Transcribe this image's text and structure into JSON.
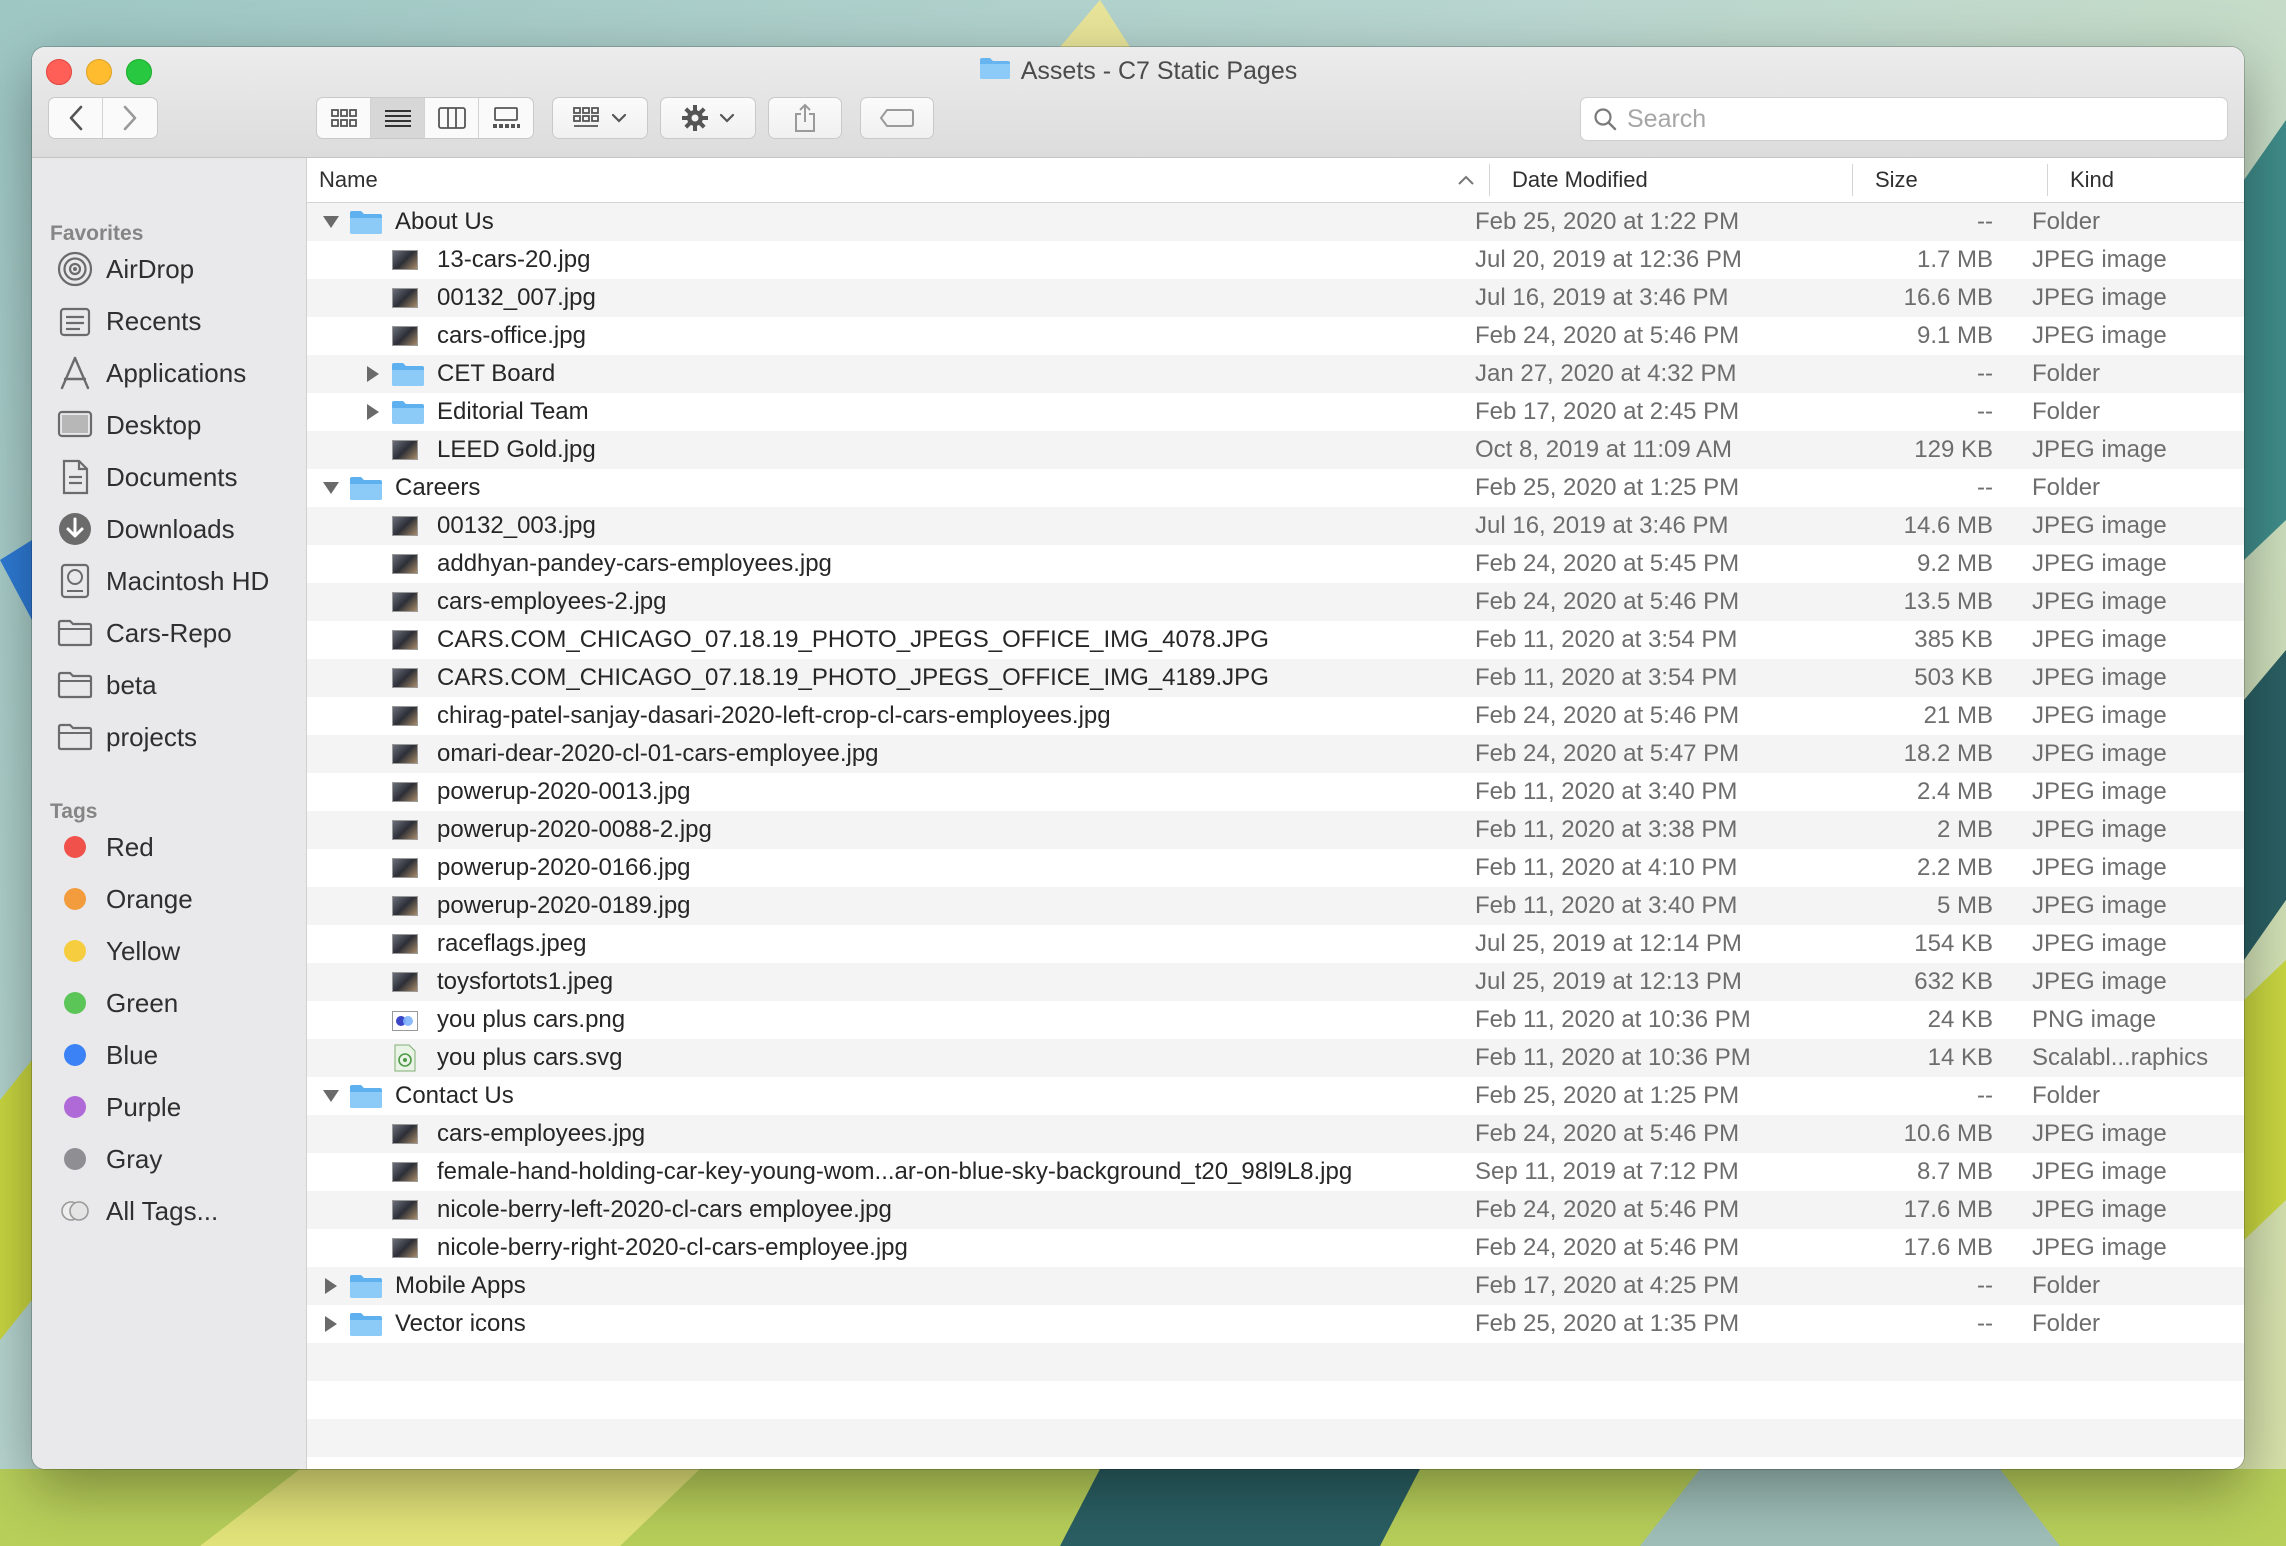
{
  "window": {
    "title": "Assets - C7 Static Pages"
  },
  "toolbar": {
    "back_icon": "chevron-left-icon",
    "forward_icon": "chevron-right-icon",
    "views": [
      "icon-view-icon",
      "list-view-icon",
      "column-view-icon",
      "gallery-view-icon"
    ],
    "active_view": "list",
    "search_placeholder": "Search"
  },
  "sidebar": {
    "favorites_heading": "Favorites",
    "favorites": [
      {
        "label": "AirDrop",
        "icon": "airdrop-icon"
      },
      {
        "label": "Recents",
        "icon": "recents-icon"
      },
      {
        "label": "Applications",
        "icon": "applications-icon"
      },
      {
        "label": "Desktop",
        "icon": "desktop-icon"
      },
      {
        "label": "Documents",
        "icon": "documents-icon"
      },
      {
        "label": "Downloads",
        "icon": "downloads-icon"
      },
      {
        "label": "Macintosh HD",
        "icon": "hard-drive-icon"
      },
      {
        "label": "Cars-Repo",
        "icon": "folder-icon"
      },
      {
        "label": "beta",
        "icon": "folder-icon"
      },
      {
        "label": "projects",
        "icon": "folder-icon"
      }
    ],
    "tags_heading": "Tags",
    "tags": [
      {
        "label": "Red",
        "color": "#f0524b"
      },
      {
        "label": "Orange",
        "color": "#f39c3e"
      },
      {
        "label": "Yellow",
        "color": "#f6cd3e"
      },
      {
        "label": "Green",
        "color": "#5bc657"
      },
      {
        "label": "Blue",
        "color": "#3b82f6"
      },
      {
        "label": "Purple",
        "color": "#b06ad8"
      },
      {
        "label": "Gray",
        "color": "#8e8e93"
      },
      {
        "label": "All Tags...",
        "color": ""
      }
    ]
  },
  "columns": {
    "name": "Name",
    "date": "Date Modified",
    "size": "Size",
    "kind": "Kind"
  },
  "rows": [
    {
      "level": 0,
      "type": "folder",
      "expanded": true,
      "name": "About Us",
      "date": "Feb 25, 2020 at 1:22 PM",
      "size": "--",
      "kind": "Folder"
    },
    {
      "level": 1,
      "type": "image",
      "name": "13-cars-20.jpg",
      "date": "Jul 20, 2019 at 12:36 PM",
      "size": "1.7 MB",
      "kind": "JPEG image"
    },
    {
      "level": 1,
      "type": "image",
      "name": "00132_007.jpg",
      "date": "Jul 16, 2019 at 3:46 PM",
      "size": "16.6 MB",
      "kind": "JPEG image"
    },
    {
      "level": 1,
      "type": "image",
      "name": "cars-office.jpg",
      "date": "Feb 24, 2020 at 5:46 PM",
      "size": "9.1 MB",
      "kind": "JPEG image"
    },
    {
      "level": 1,
      "type": "folder",
      "expanded": false,
      "name": "CET Board",
      "date": "Jan 27, 2020 at 4:32 PM",
      "size": "--",
      "kind": "Folder"
    },
    {
      "level": 1,
      "type": "folder",
      "expanded": false,
      "name": "Editorial Team",
      "date": "Feb 17, 2020 at 2:45 PM",
      "size": "--",
      "kind": "Folder"
    },
    {
      "level": 1,
      "type": "image",
      "name": "LEED Gold.jpg",
      "date": "Oct 8, 2019 at 11:09 AM",
      "size": "129 KB",
      "kind": "JPEG image"
    },
    {
      "level": 0,
      "type": "folder",
      "expanded": true,
      "name": "Careers",
      "date": "Feb 25, 2020 at 1:25 PM",
      "size": "--",
      "kind": "Folder"
    },
    {
      "level": 1,
      "type": "image",
      "name": "00132_003.jpg",
      "date": "Jul 16, 2019 at 3:46 PM",
      "size": "14.6 MB",
      "kind": "JPEG image"
    },
    {
      "level": 1,
      "type": "image",
      "name": "addhyan-pandey-cars-employees.jpg",
      "date": "Feb 24, 2020 at 5:45 PM",
      "size": "9.2 MB",
      "kind": "JPEG image"
    },
    {
      "level": 1,
      "type": "image",
      "name": "cars-employees-2.jpg",
      "date": "Feb 24, 2020 at 5:46 PM",
      "size": "13.5 MB",
      "kind": "JPEG image"
    },
    {
      "level": 1,
      "type": "image",
      "name": "CARS.COM_CHICAGO_07.18.19_PHOTO_JPEGS_OFFICE_IMG_4078.JPG",
      "date": "Feb 11, 2020 at 3:54 PM",
      "size": "385 KB",
      "kind": "JPEG image"
    },
    {
      "level": 1,
      "type": "image",
      "name": "CARS.COM_CHICAGO_07.18.19_PHOTO_JPEGS_OFFICE_IMG_4189.JPG",
      "date": "Feb 11, 2020 at 3:54 PM",
      "size": "503 KB",
      "kind": "JPEG image"
    },
    {
      "level": 1,
      "type": "image",
      "name": "chirag-patel-sanjay-dasari-2020-left-crop-cl-cars-employees.jpg",
      "date": "Feb 24, 2020 at 5:46 PM",
      "size": "21 MB",
      "kind": "JPEG image"
    },
    {
      "level": 1,
      "type": "image",
      "name": "omari-dear-2020-cl-01-cars-employee.jpg",
      "date": "Feb 24, 2020 at 5:47 PM",
      "size": "18.2 MB",
      "kind": "JPEG image"
    },
    {
      "level": 1,
      "type": "image",
      "name": "powerup-2020-0013.jpg",
      "date": "Feb 11, 2020 at 3:40 PM",
      "size": "2.4 MB",
      "kind": "JPEG image"
    },
    {
      "level": 1,
      "type": "image",
      "name": "powerup-2020-0088-2.jpg",
      "date": "Feb 11, 2020 at 3:38 PM",
      "size": "2 MB",
      "kind": "JPEG image"
    },
    {
      "level": 1,
      "type": "image",
      "name": "powerup-2020-0166.jpg",
      "date": "Feb 11, 2020 at 4:10 PM",
      "size": "2.2 MB",
      "kind": "JPEG image"
    },
    {
      "level": 1,
      "type": "image",
      "name": "powerup-2020-0189.jpg",
      "date": "Feb 11, 2020 at 3:40 PM",
      "size": "5 MB",
      "kind": "JPEG image"
    },
    {
      "level": 1,
      "type": "image",
      "name": "raceflags.jpeg",
      "date": "Jul 25, 2019 at 12:14 PM",
      "size": "154 KB",
      "kind": "JPEG image"
    },
    {
      "level": 1,
      "type": "image",
      "name": "toysfortots1.jpeg",
      "date": "Jul 25, 2019 at 12:13 PM",
      "size": "632 KB",
      "kind": "JPEG image"
    },
    {
      "level": 1,
      "type": "png",
      "name": "you plus cars.png",
      "date": "Feb 11, 2020 at 10:36 PM",
      "size": "24 KB",
      "kind": "PNG image"
    },
    {
      "level": 1,
      "type": "svg",
      "name": "you plus cars.svg",
      "date": "Feb 11, 2020 at 10:36 PM",
      "size": "14 KB",
      "kind": "Scalabl...raphics"
    },
    {
      "level": 0,
      "type": "folder",
      "expanded": true,
      "name": "Contact Us",
      "date": "Feb 25, 2020 at 1:25 PM",
      "size": "--",
      "kind": "Folder"
    },
    {
      "level": 1,
      "type": "image",
      "name": "cars-employees.jpg",
      "date": "Feb 24, 2020 at 5:46 PM",
      "size": "10.6 MB",
      "kind": "JPEG image"
    },
    {
      "level": 1,
      "type": "image",
      "name": "female-hand-holding-car-key-young-wom...ar-on-blue-sky-background_t20_98l9L8.jpg",
      "date": "Sep 11, 2019 at 7:12 PM",
      "size": "8.7 MB",
      "kind": "JPEG image"
    },
    {
      "level": 1,
      "type": "image",
      "name": "nicole-berry-left-2020-cl-cars employee.jpg",
      "date": "Feb 24, 2020 at 5:46 PM",
      "size": "17.6 MB",
      "kind": "JPEG image"
    },
    {
      "level": 1,
      "type": "image",
      "name": "nicole-berry-right-2020-cl-cars-employee.jpg",
      "date": "Feb 24, 2020 at 5:46 PM",
      "size": "17.6 MB",
      "kind": "JPEG image"
    },
    {
      "level": 0,
      "type": "folder",
      "expanded": false,
      "name": "Mobile Apps",
      "date": "Feb 17, 2020 at 4:25 PM",
      "size": "--",
      "kind": "Folder"
    },
    {
      "level": 0,
      "type": "folder",
      "expanded": false,
      "name": "Vector icons",
      "date": "Feb 25, 2020 at 1:35 PM",
      "size": "--",
      "kind": "Folder"
    }
  ]
}
